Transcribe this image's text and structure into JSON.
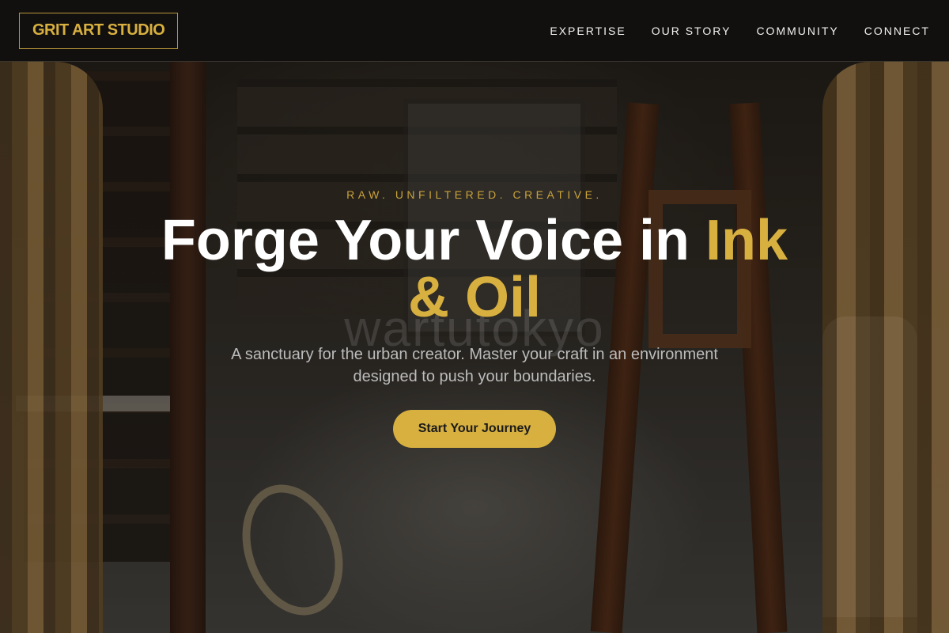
{
  "brand": {
    "logo_text": "GRIT ART STUDIO",
    "accent_color": "#d8b040"
  },
  "nav": {
    "items": [
      {
        "label": "EXPERTISE"
      },
      {
        "label": "OUR STORY"
      },
      {
        "label": "COMMUNITY"
      },
      {
        "label": "CONNECT"
      }
    ]
  },
  "hero": {
    "eyebrow": "RAW. UNFILTERED. CREATIVE.",
    "headline_main": "Forge Your Voice in ",
    "headline_accent": "Ink & Oil",
    "watermark": "wartutokyo",
    "subtitle": "A sanctuary for the urban creator. Master your craft in an environment designed to push your boundaries.",
    "cta_label": "Start Your Journey",
    "background": "art studio interior with easels, shelves and curtains"
  }
}
